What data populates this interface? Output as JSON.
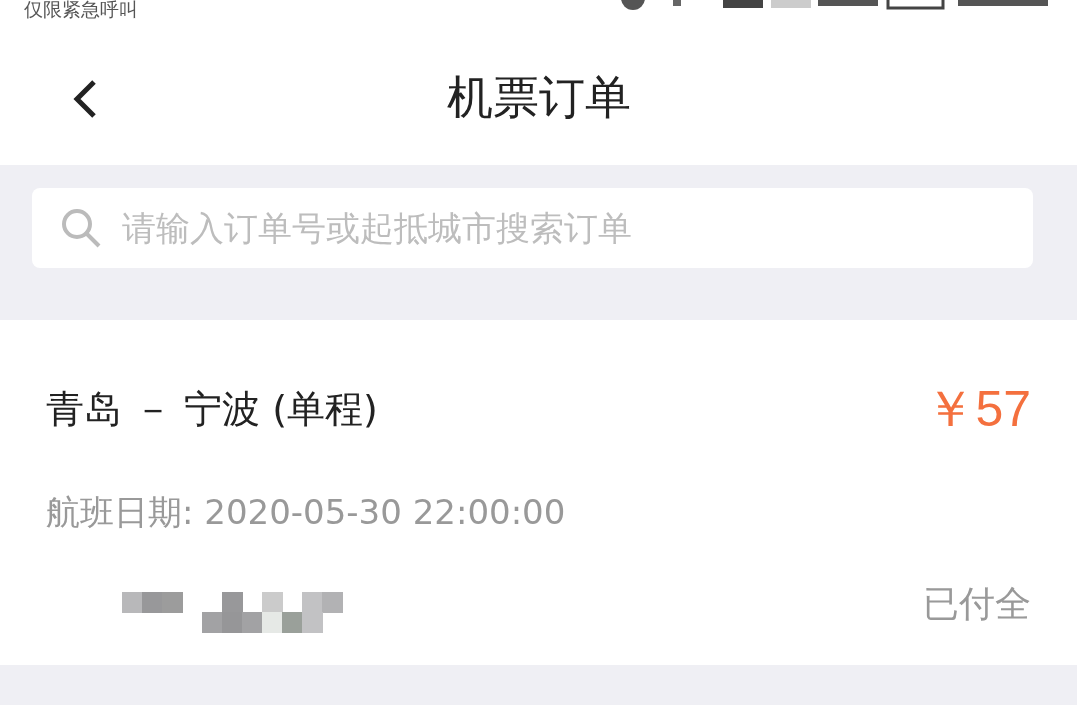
{
  "status_bar": {
    "carrier": "仅限紧急呼叫"
  },
  "header": {
    "title": "机票订单"
  },
  "search": {
    "placeholder": "请输入订单号或起抵城市搜索订单"
  },
  "orders": [
    {
      "route": "青岛 － 宁波 (单程)",
      "price": "￥57",
      "date": "航班日期: 2020-05-30 22:00:00",
      "status": "已付全"
    }
  ]
}
